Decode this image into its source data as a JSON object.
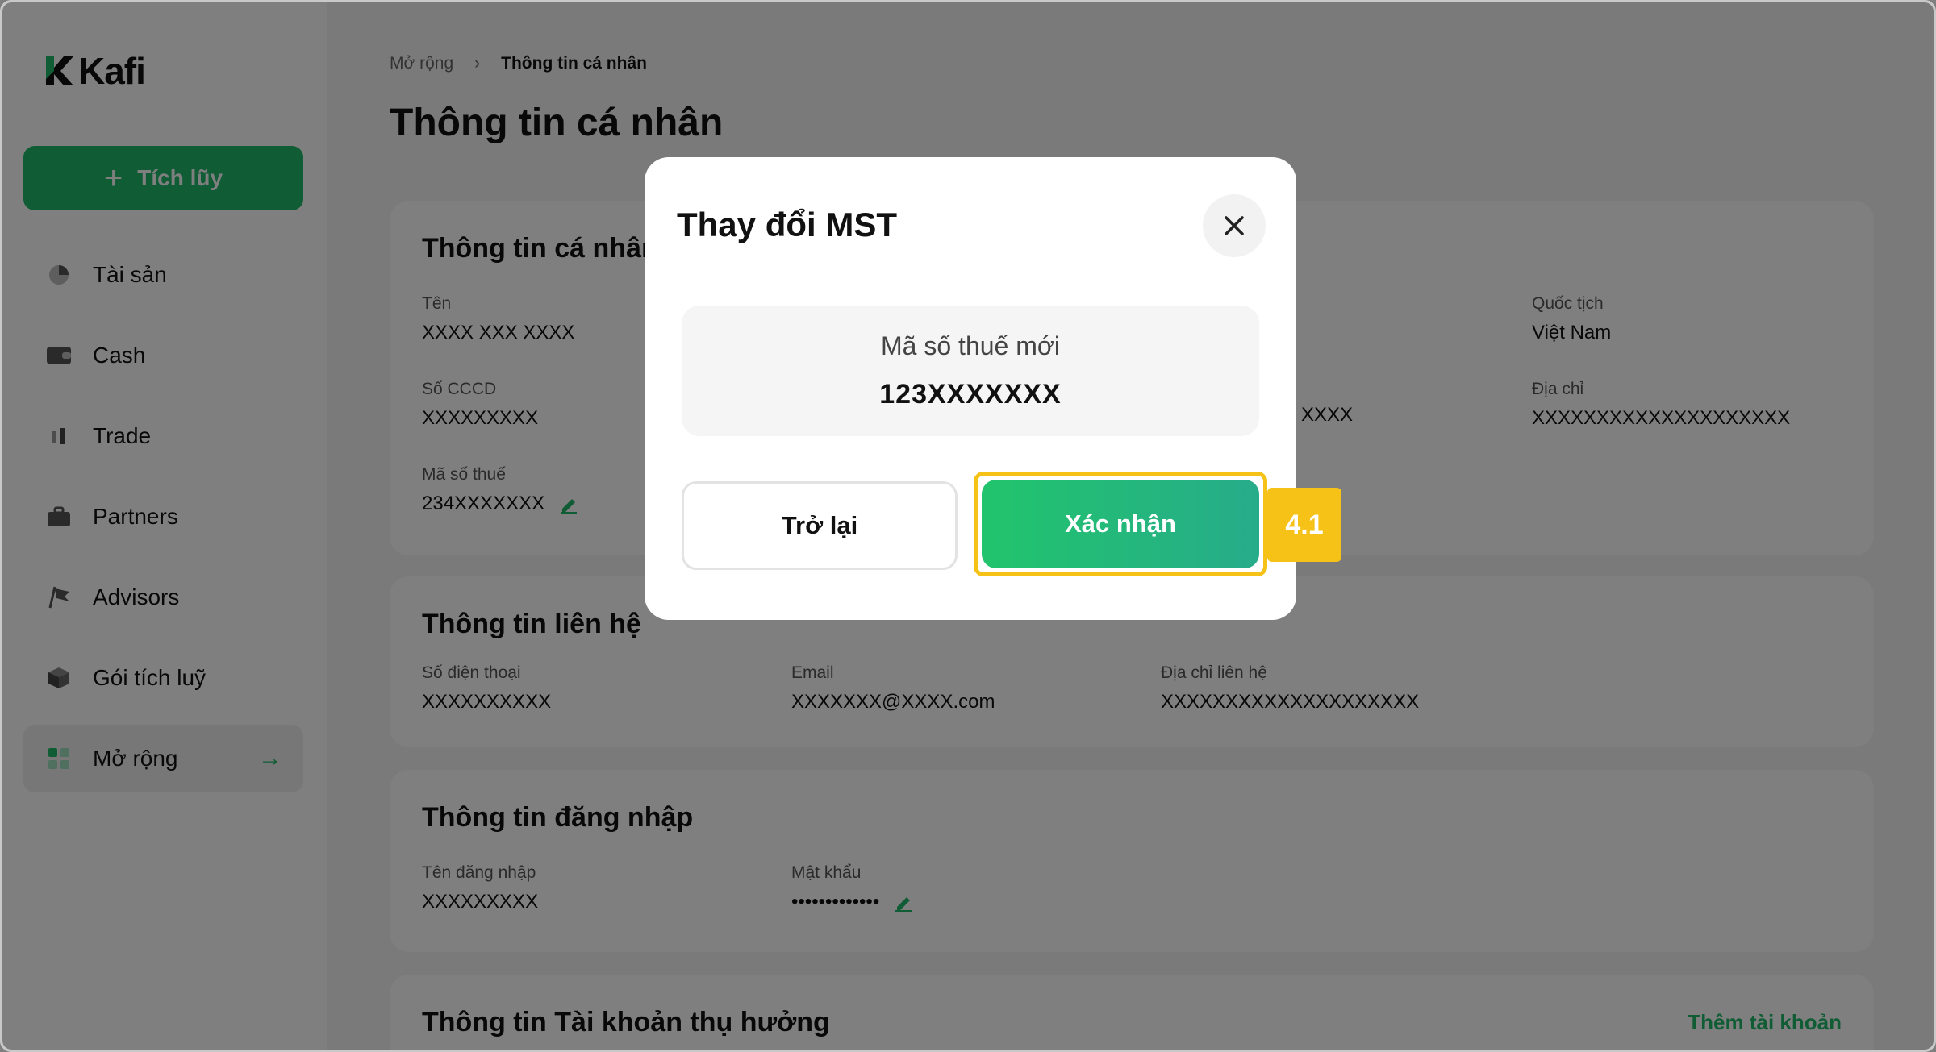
{
  "brand": {
    "name": "Kafi",
    "accent": "#1fb86a"
  },
  "sidebar": {
    "primary_button": "Tích lũy",
    "items": [
      {
        "label": "Tài sản",
        "icon": "pie-chart-icon"
      },
      {
        "label": "Cash",
        "icon": "wallet-icon"
      },
      {
        "label": "Trade",
        "icon": "candlestick-icon"
      },
      {
        "label": "Partners",
        "icon": "briefcase-icon"
      },
      {
        "label": "Advisors",
        "icon": "flag-icon"
      },
      {
        "label": "Gói tích luỹ",
        "icon": "box-icon"
      },
      {
        "label": "Mở rộng",
        "icon": "grid-icon",
        "active": true
      }
    ]
  },
  "breadcrumb": {
    "parent": "Mở rộng",
    "current": "Thông tin cá nhân"
  },
  "page_title": "Thông tin cá nhân",
  "personal": {
    "title": "Thông tin cá nhân",
    "name_label": "Tên",
    "name_value": "XXXX XXX XXXX",
    "id_label": "Số CCCD",
    "id_value": "XXXXXXXXX",
    "tax_label": "Mã số thuế",
    "tax_value": "234XXXXXXX",
    "middle_value": "XXXX",
    "nationality_label": "Quốc tịch",
    "nationality_value": "Việt Nam",
    "address_label": "Địa chỉ",
    "address_value": "XXXXXXXXXXXXXXXXXXXX"
  },
  "contact": {
    "title": "Thông tin liên hệ",
    "phone_label": "Số điện thoại",
    "phone_value": "XXXXXXXXXX",
    "email_label": "Email",
    "email_value": "XXXXXXX@XXXX.com",
    "address_label": "Địa chỉ liên hệ",
    "address_value": "XXXXXXXXXXXXXXXXXXXX"
  },
  "login": {
    "title": "Thông tin đăng nhập",
    "username_label": "Tên đăng nhập",
    "username_value": "XXXXXXXXX",
    "password_label": "Mật khẩu",
    "password_value": "•••••••••••••"
  },
  "beneficiary": {
    "title": "Thông tin Tài khoản thụ hưởng",
    "add_link": "Thêm tài khoản"
  },
  "modal": {
    "title": "Thay đổi MST",
    "field_label": "Mã số thuế mới",
    "field_value": "123XXXXXXX",
    "back_label": "Trở lại",
    "confirm_label": "Xác nhận"
  },
  "step_badge": "4.1"
}
